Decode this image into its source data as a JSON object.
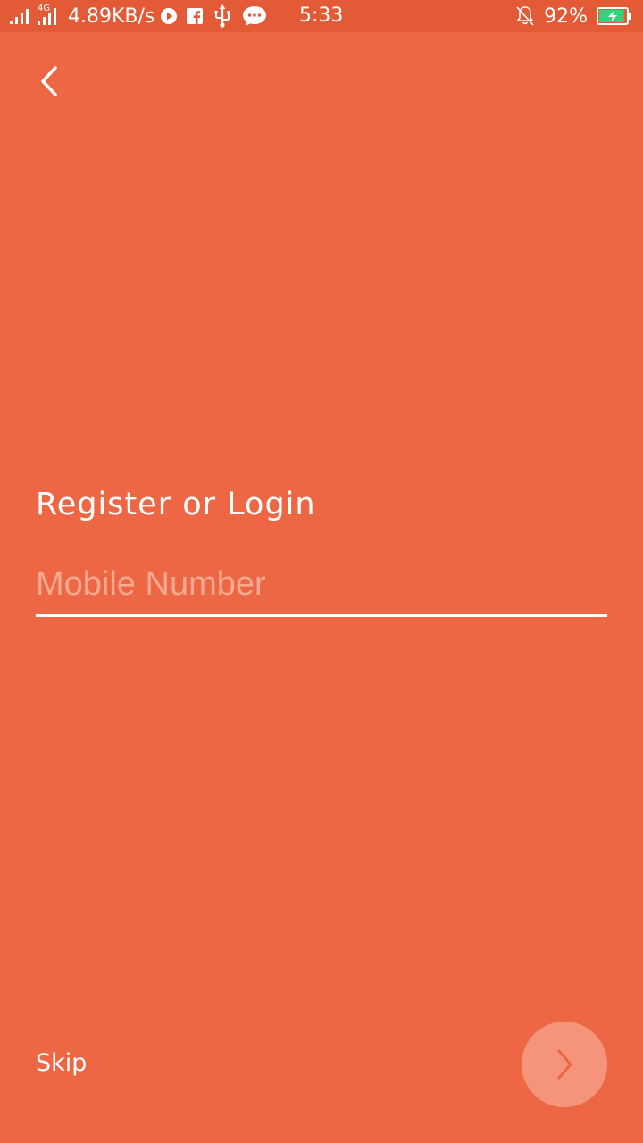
{
  "status_bar": {
    "network_type": "4G",
    "data_speed": "4.89KB/s",
    "time": "5:33",
    "battery_percent": "92%",
    "battery_level": 0.92,
    "icons": [
      "signal-icon",
      "4g-signal-icon",
      "play-icon",
      "facebook-icon",
      "usb-icon",
      "chat-bubble-icon",
      "bell-off-icon",
      "battery-charging-icon"
    ]
  },
  "header": {
    "back_icon": "chevron-left-icon"
  },
  "main": {
    "title": "Register or Login",
    "mobile_placeholder": "Mobile Number",
    "mobile_value": ""
  },
  "footer": {
    "skip_label": "Skip",
    "next_icon": "chevron-right-icon"
  },
  "colors": {
    "background": "#EE6744",
    "status_bar": "#E35A36",
    "placeholder": "#F8A98F",
    "next_button": "#F4947A",
    "next_chevron": "#EE6744",
    "battery_fill": "#34D27B"
  }
}
